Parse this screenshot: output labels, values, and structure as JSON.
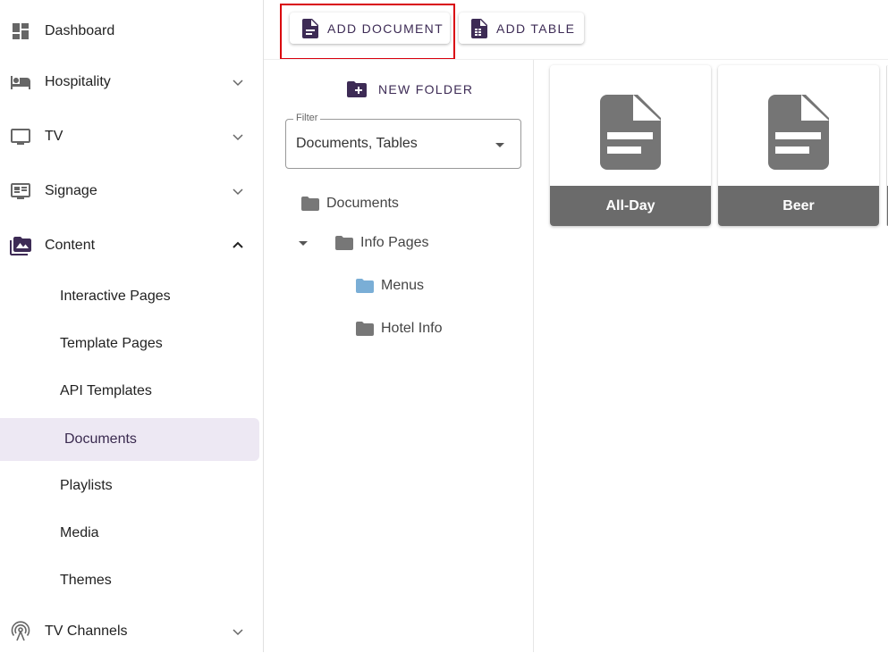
{
  "sidebar": {
    "items": [
      {
        "label": "Dashboard",
        "icon": "dashboard-icon"
      },
      {
        "label": "Hospitality",
        "icon": "bed-icon"
      },
      {
        "label": "TV",
        "icon": "tv-icon"
      },
      {
        "label": "Signage",
        "icon": "signage-icon"
      },
      {
        "label": "Content",
        "icon": "content-icon"
      },
      {
        "label": "TV Channels",
        "icon": "antenna-icon"
      }
    ],
    "content_sub": [
      "Interactive Pages",
      "Template Pages",
      "API Templates",
      "Documents",
      "Playlists",
      "Media",
      "Themes"
    ],
    "selected": "Documents"
  },
  "toolbar": {
    "add_document": "ADD DOCUMENT",
    "add_table": "ADD TABLE"
  },
  "folders": {
    "new_folder": "NEW FOLDER",
    "filter_label": "Filter",
    "filter_value": "Documents, Tables",
    "tree": [
      "Documents",
      "Info Pages",
      "Menus",
      "Hotel Info"
    ]
  },
  "cards": [
    "All-Day",
    "Beer"
  ],
  "colors": {
    "accent": "#3d2b55",
    "highlight": "#d9000d",
    "selected_bg": "#ede8f3",
    "card_band": "#6b6b6b",
    "active_folder": "#7aaed6"
  }
}
